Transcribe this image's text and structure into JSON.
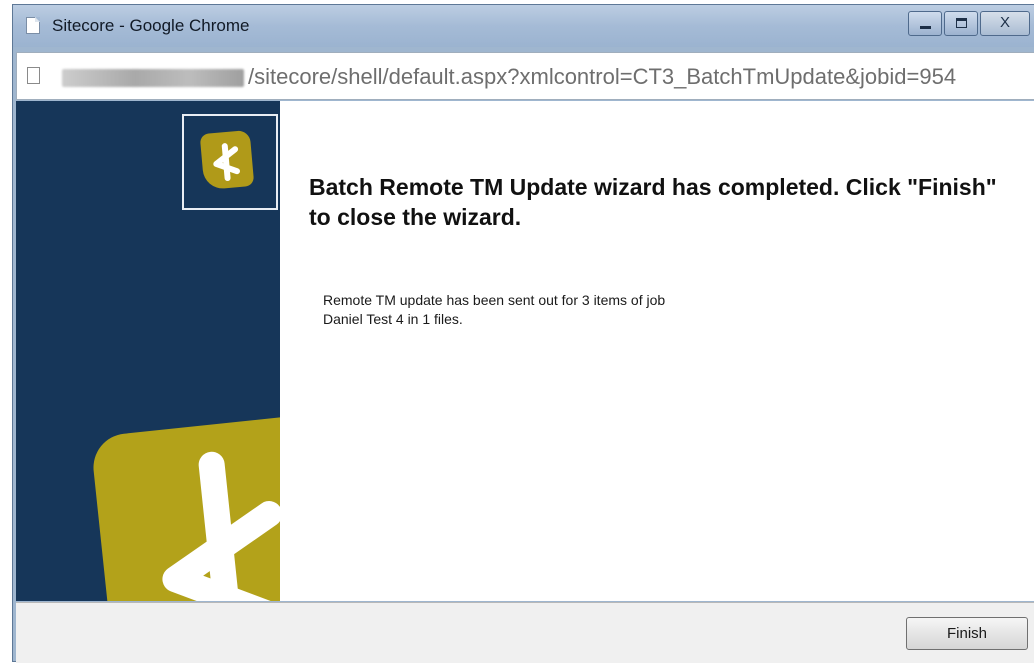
{
  "window": {
    "title": "Sitecore - Google Chrome",
    "controls": {
      "minimize": "minimize",
      "maximize": "maximize",
      "close": "X"
    }
  },
  "address": {
    "url_visible": "/sitecore/shell/default.aspx?xmlcontrol=CT3_BatchTmUpdate&jobid=954",
    "host_obscured": true
  },
  "icons": {
    "page": "page-icon",
    "logo": "sitecore-logo-icon"
  },
  "wizard": {
    "heading": "Batch Remote TM Update wizard has completed. Click \"Finish\" to close the wizard.",
    "message_line1": "Remote TM update has been sent out for 3 items of job",
    "message_line2": "Daniel Test 4 in 1 files.",
    "finish_label": "Finish"
  },
  "colors": {
    "sidebar": "#163659",
    "logo_gold": "#b3a21a",
    "titlebar": "#a5bbd6"
  }
}
